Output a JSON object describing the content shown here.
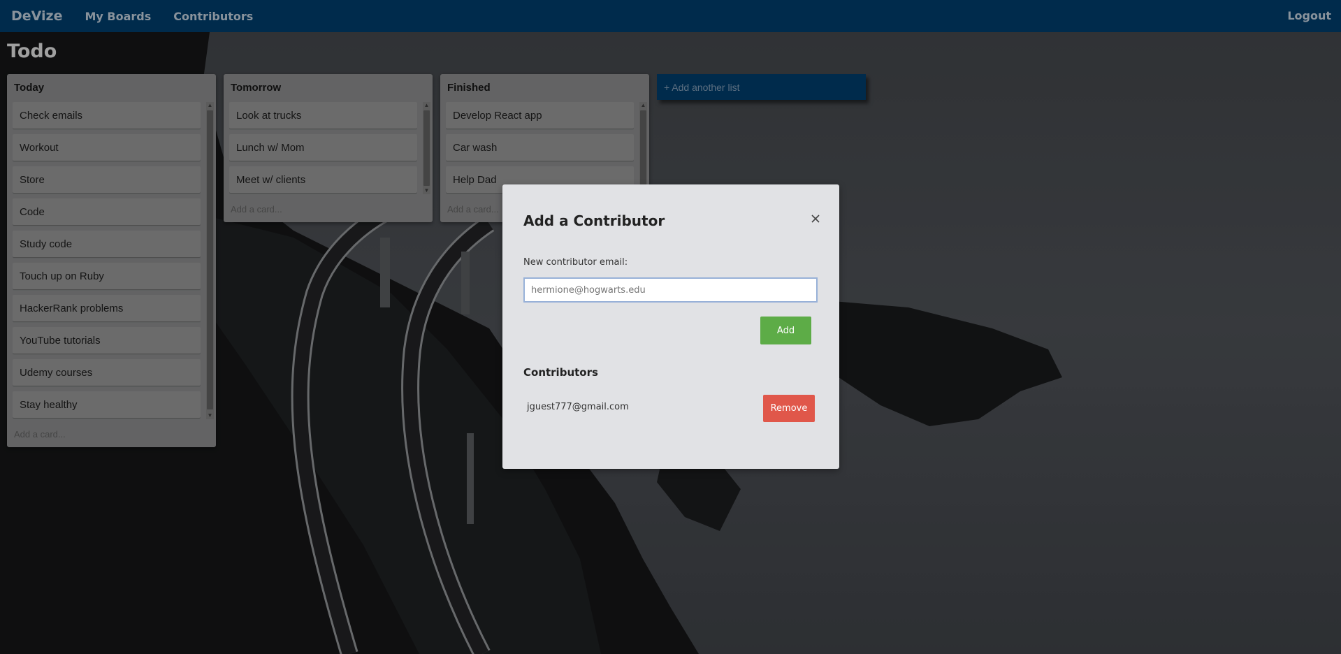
{
  "navbar": {
    "brand": "DeVize",
    "links": [
      "My Boards",
      "Contributors"
    ],
    "logout": "Logout"
  },
  "board": {
    "title": "Todo",
    "lists": [
      {
        "title": "Today",
        "cards": [
          "Check emails",
          "Workout",
          "Store",
          "Code",
          "Study code",
          "Touch up on Ruby",
          "HackerRank problems",
          "YouTube tutorials",
          "Udemy courses",
          "Stay healthy"
        ],
        "add_card": "Add a card..."
      },
      {
        "title": "Tomorrow",
        "cards": [
          "Look at trucks",
          "Lunch w/ Mom",
          "Meet w/ clients"
        ],
        "add_card": "Add a card..."
      },
      {
        "title": "Finished",
        "cards": [
          "Develop React app",
          "Car wash",
          "Help Dad"
        ],
        "add_card": "Add a card..."
      }
    ],
    "add_list": "+ Add another list"
  },
  "modal": {
    "title": "Add a Contributor",
    "field_label": "New contributor email:",
    "email_placeholder": "hermione@hogwarts.edu",
    "add_button": "Add",
    "contributors_heading": "Contributors",
    "contributors": [
      {
        "email": "jguest777@gmail.com",
        "remove_label": "Remove"
      }
    ]
  },
  "colors": {
    "navbar": "#003a66",
    "add_button": "#5dac47",
    "remove_button": "#e0574a",
    "modal_background": "#e1e2e5"
  },
  "icons": {
    "close": "close-icon"
  }
}
